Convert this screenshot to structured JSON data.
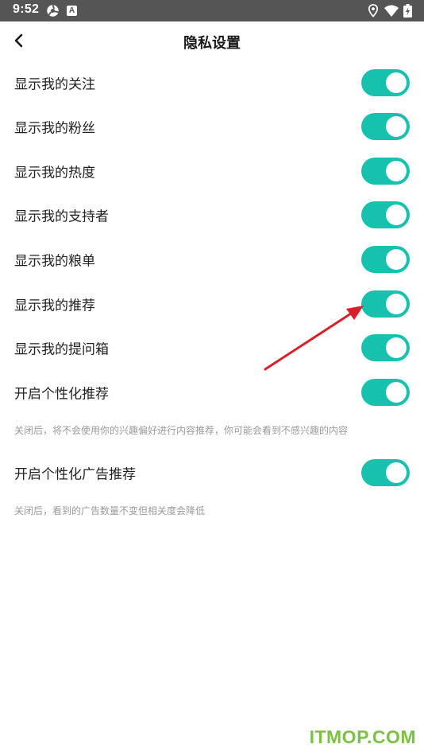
{
  "status_bar": {
    "time": "9:52",
    "icons": [
      "gear-icon",
      "a-badge-icon",
      "location-icon",
      "wifi-icon",
      "battery-charging-icon"
    ],
    "a_badge": "A"
  },
  "header": {
    "back_icon": "chevron-left-icon",
    "title": "隐私设置"
  },
  "settings": [
    {
      "label": "显示我的关注",
      "enabled": true
    },
    {
      "label": "显示我的粉丝",
      "enabled": true
    },
    {
      "label": "显示我的热度",
      "enabled": true
    },
    {
      "label": "显示我的支持者",
      "enabled": true
    },
    {
      "label": "显示我的粮单",
      "enabled": true
    },
    {
      "label": "显示我的推荐",
      "enabled": true
    },
    {
      "label": "显示我的提问箱",
      "enabled": true
    },
    {
      "label": "开启个性化推荐",
      "enabled": true,
      "description": "关闭后，将不会使用你的兴趣偏好进行内容推荐，你可能会看到不感兴趣的内容"
    },
    {
      "label": "开启个性化广告推荐",
      "enabled": true,
      "description": "关闭后，看到的广告数量不变但相关度会降低"
    }
  ],
  "colors": {
    "toggle_on": "#16c1ae",
    "status_bar": "#555555",
    "annotation_arrow": "#d9202a",
    "watermark": "#7cc242"
  },
  "watermark": "ITMOP.COM"
}
